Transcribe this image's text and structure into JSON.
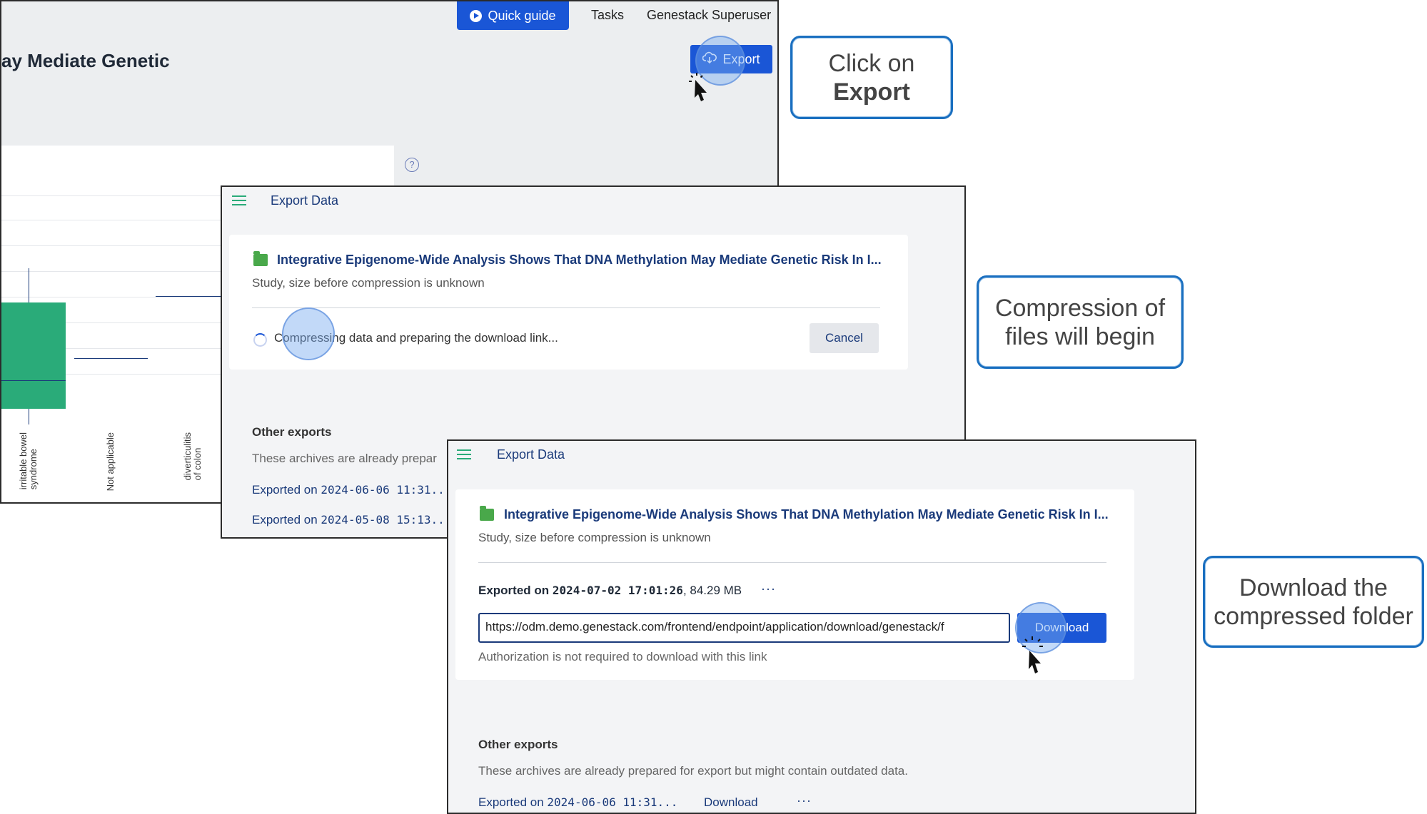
{
  "step1": {
    "nav": {
      "quick_guide": "Quick guide",
      "tasks": "Tasks",
      "user": "Genestack Superuser"
    },
    "page_title_fragment": "ay Mediate Genetic",
    "export_button": "Export",
    "help_icon": "?",
    "plot": {
      "x_labels": [
        "irritable bowel\nsyndrome",
        "Not applicable",
        "diverticulitis\nof colon"
      ]
    },
    "callout": {
      "line1": "Click on",
      "line2": "Export"
    }
  },
  "step2": {
    "panel_title": "Export Data",
    "study_title": "Integrative Epigenome-Wide Analysis Shows That DNA Methylation May Mediate Genetic Risk In I...",
    "study_subtitle": "Study, size before compression is unknown",
    "status_text": "Compressing data and preparing the download link...",
    "cancel_button": "Cancel",
    "other_exports": {
      "title": "Other exports",
      "description": "These archives are already prepar",
      "items": [
        {
          "prefix": "Exported on ",
          "date": "2024-06-06 11:31..."
        },
        {
          "prefix": "Exported on ",
          "date": "2024-05-08 15:13..."
        }
      ]
    },
    "callout": {
      "line1": "Compression of",
      "line2": "files will begin"
    }
  },
  "step3": {
    "panel_title": "Export Data",
    "study_title": "Integrative Epigenome-Wide Analysis Shows That DNA Methylation May Mediate Genetic Risk In I...",
    "study_subtitle": "Study, size before compression is unknown",
    "export_info": {
      "prefix": "Exported on ",
      "date": "2024-07-02 17:01:26",
      "size": ", 84.29 MB",
      "more": "···"
    },
    "url_value": "https://odm.demo.genestack.com/frontend/endpoint/application/download/genestack/f",
    "download_button": "Download",
    "auth_note": "Authorization is not required to download with this link",
    "other_exports": {
      "title": "Other exports",
      "description": "These archives are already prepared for export but might contain outdated data.",
      "items": [
        {
          "prefix": "Exported on ",
          "date": "2024-06-06 11:31...",
          "download": "Download",
          "more": "···"
        }
      ]
    },
    "callout": {
      "line1": "Download the",
      "line2": "compressed folder"
    }
  },
  "colors": {
    "primary": "#1a56d6",
    "navy_text": "#1a3a7a",
    "green": "#2aab79",
    "callout_border": "#1a6fc0"
  }
}
